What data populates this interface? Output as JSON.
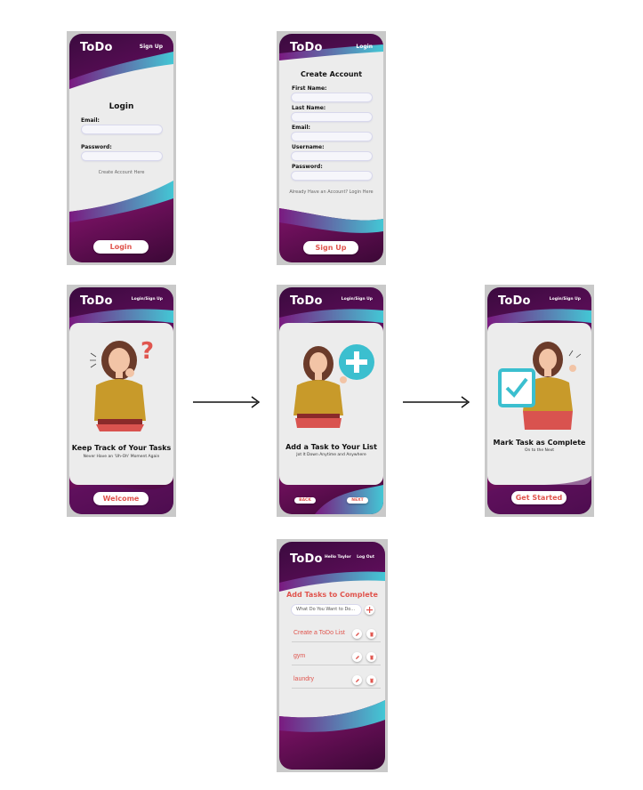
{
  "brand": "ToDo",
  "colors": {
    "accent": "#e0554e",
    "purple": "#6a0f63",
    "teal": "#3bbfcf",
    "card": "#ececec"
  },
  "login_screen": {
    "top_link": "Sign Up",
    "title": "Login",
    "email_label": "Email:",
    "password_label": "Password:",
    "create_link": "Create Account Here",
    "button": "Login"
  },
  "signup_screen": {
    "top_link": "Login",
    "title": "Create Account",
    "fields": [
      "First Name:",
      "Last Name:",
      "Email:",
      "Username:",
      "Password:"
    ],
    "login_link": "Already Have an Account? Login Here",
    "button": "Sign Up"
  },
  "onboard1": {
    "top_link": "Login/Sign Up",
    "heading": "Keep Track of Your Tasks",
    "sub": "Never Have an 'Uh-Oh' Moment Again",
    "button": "Welcome"
  },
  "onboard2": {
    "top_link": "Login/Sign Up",
    "heading": "Add a Task to Your List",
    "sub": "Jot It Down Anytime and Anywhere",
    "back": "BACK",
    "next": "NEXT"
  },
  "onboard3": {
    "top_link": "Login/Sign Up",
    "heading": "Mark Task as Complete",
    "sub": "On to the Next",
    "button": "Get Started"
  },
  "todo_screen": {
    "greeting": "Hello Taylor",
    "logout": "Log Out",
    "title": "Add Tasks to Complete",
    "input_placeholder": "What Do You Want to Do...",
    "tasks": [
      "Create a ToDo List",
      "gym",
      "laundry"
    ]
  }
}
